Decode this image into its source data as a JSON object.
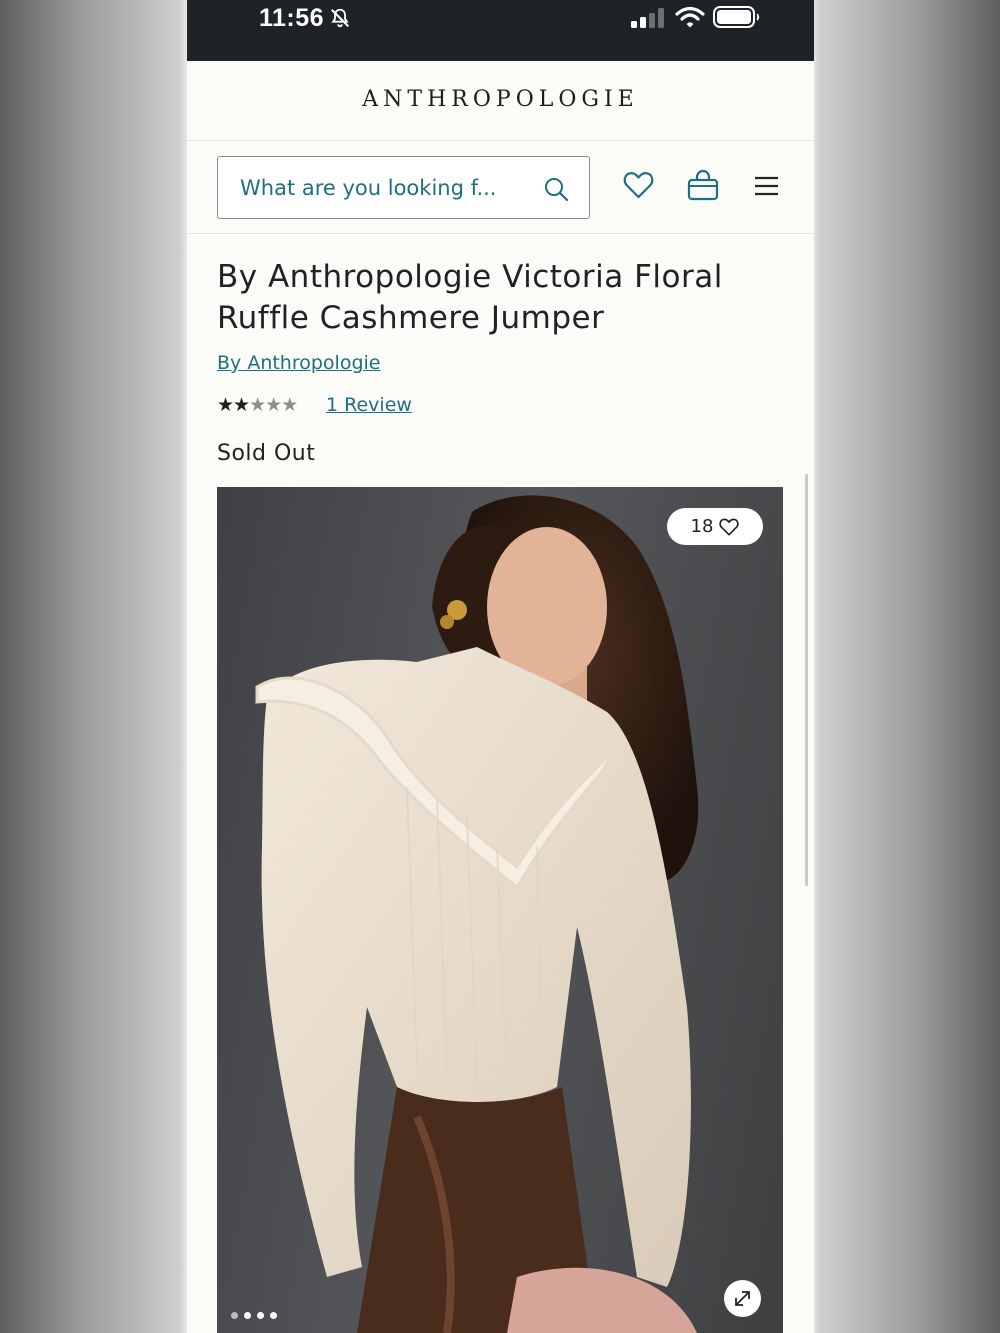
{
  "status_bar": {
    "time": "11:56"
  },
  "header": {
    "logo": "ANTHROPOLOGIE"
  },
  "search": {
    "placeholder": "What are you looking f..."
  },
  "product": {
    "title": "By Anthropologie Victoria Floral Ruffle Cashmere Jumper",
    "brand": "By Anthropologie",
    "rating": {
      "filled_stars": 2,
      "total_stars": 5,
      "review_link": "1 Review"
    },
    "availability": "Sold Out",
    "image": {
      "favorites_count": "18",
      "carousel": {
        "count": 4,
        "active_index": 0
      }
    }
  },
  "icons": [
    "bell-muted-icon",
    "signal-icon",
    "wifi-icon",
    "battery-icon",
    "search-icon",
    "heart-icon",
    "bag-icon",
    "menu-icon",
    "expand-icon"
  ]
}
